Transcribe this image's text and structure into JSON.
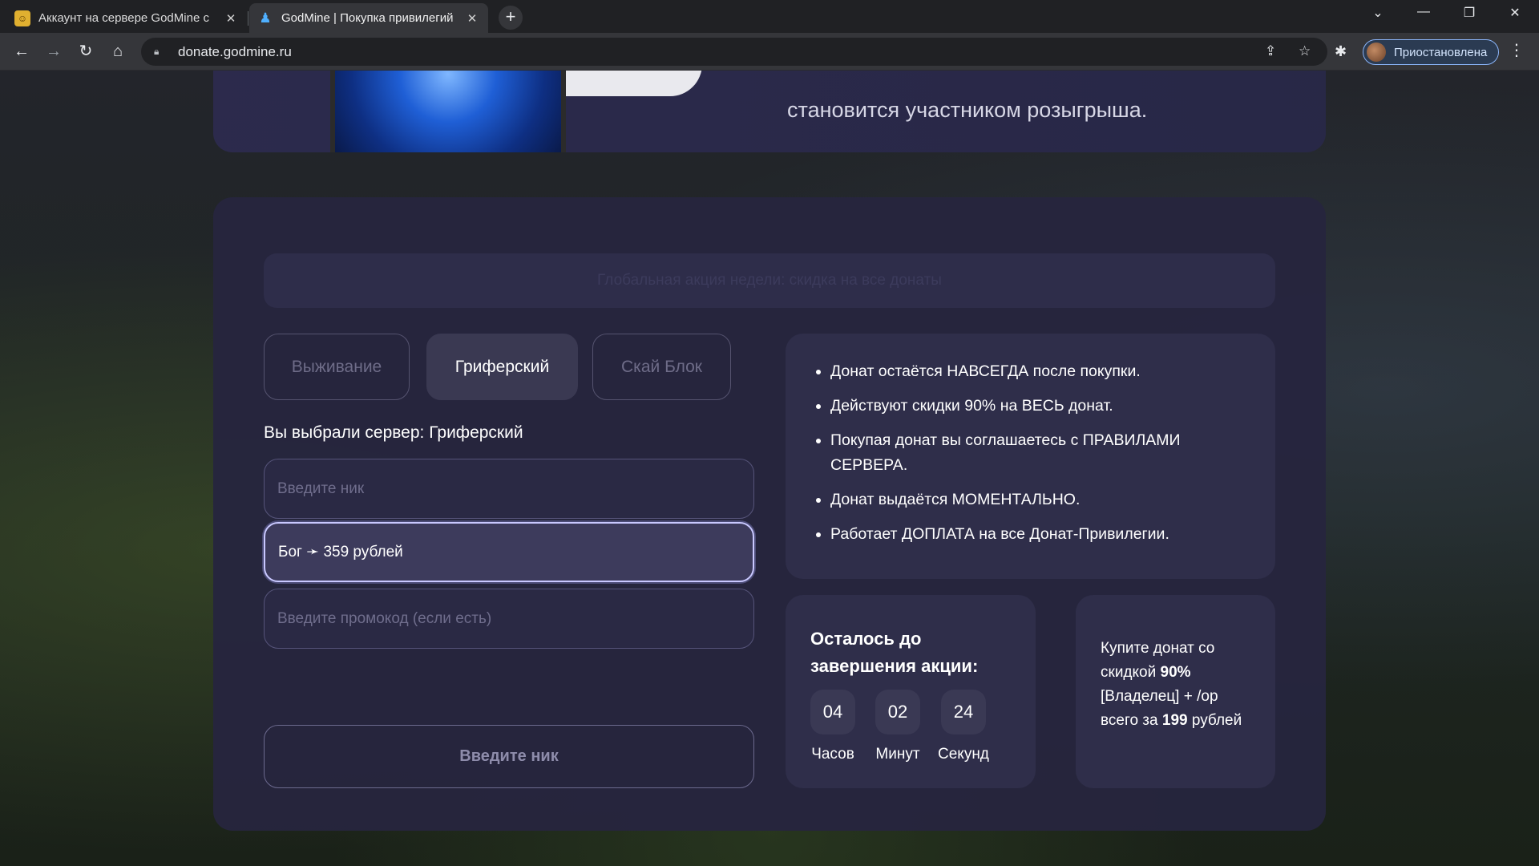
{
  "browser": {
    "tabs": [
      {
        "title": "Аккаунт на сервере GodMine с",
        "active": false
      },
      {
        "title": "GodMine | Покупка привилегий",
        "active": true
      }
    ],
    "close_glyph": "✕",
    "new_tab_glyph": "+",
    "url": "donate.godmine.ru",
    "profile_label": "Приостановлена",
    "icons": [
      "back-icon",
      "forward-icon",
      "reload-icon",
      "home-icon",
      "lock-icon",
      "share-icon",
      "star-icon",
      "extensions-icon",
      "menu-icon"
    ]
  },
  "promo": {
    "text": "становится участником розыгрыша."
  },
  "notice": {
    "text": "Глобальная акция недели: скидка на все донаты"
  },
  "servers": {
    "items": [
      {
        "label": "Выживание",
        "active": false
      },
      {
        "label": "Гриферский",
        "active": true
      },
      {
        "label": "Скай Блок",
        "active": false
      }
    ],
    "chosen_text": "Вы выбрали сервер: Гриферский"
  },
  "form": {
    "nick_placeholder": "Введите ник",
    "selected_rank": "Бог ➛ 359 рублей",
    "promo_placeholder": "Введите промокод (если есть)",
    "submit_label": "Введите ник"
  },
  "info": {
    "items": [
      "Донат остаётся НАВСЕГДА после покупки.",
      "Действуют скидки 90% на ВЕСЬ донат.",
      "Покупая донат вы соглашаетесь с ПРАВИЛАМИ СЕРВЕРА.",
      "Донат выдаётся МОМЕНТАЛЬНО.",
      "Работает ДОПЛАТА на все Донат-Привилегии."
    ]
  },
  "timer": {
    "title": "Осталось до завершения акции:",
    "hours": "04",
    "minutes": "02",
    "seconds": "24",
    "hours_label": "Часов",
    "minutes_label": "Минут",
    "seconds_label": "Секунд"
  },
  "deal": {
    "line1": "Купите донат со скидкой ",
    "discount": "90%",
    "line2": "[Владелец] + /op всего за ",
    "price": "199",
    "line3": " рублей"
  },
  "colors": {
    "card": "#26253e",
    "panel": "#2f2e4a",
    "accent_border": "#c9c8ff"
  }
}
